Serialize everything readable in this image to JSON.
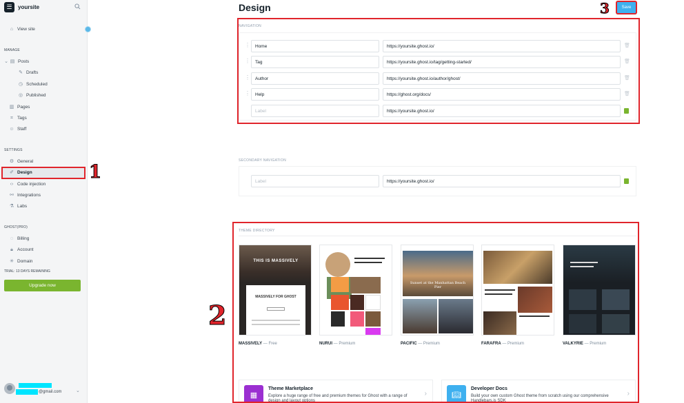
{
  "sidebar": {
    "brand": "yoursite",
    "view_site": "View site",
    "manage_heading": "MANAGE",
    "manage_items": [
      "Posts",
      "Drafts",
      "Scheduled",
      "Published",
      "Pages",
      "Tags",
      "Staff"
    ],
    "settings_heading": "SETTINGS",
    "settings_items": [
      "General",
      "Design",
      "Code injection",
      "Integrations",
      "Labs"
    ],
    "ghost_heading": "GHOST(PRO)",
    "ghost_items": [
      "Billing",
      "Account",
      "Domain"
    ],
    "trial": "TRIAL: 13 DAYS REMAINING",
    "upgrade": "Upgrade now",
    "email_suffix": "@gmail.com"
  },
  "header": {
    "title": "Design",
    "save": "Save"
  },
  "navigation": {
    "label": "NAVIGATION",
    "rows": [
      {
        "label": "Home",
        "url": "https://yoursite.ghost.io/"
      },
      {
        "label": "Tag",
        "url": "https://yoursite.ghost.io/tag/getting-started/"
      },
      {
        "label": "Author",
        "url": "https://yoursite.ghost.io/author/ghost/"
      },
      {
        "label": "Help",
        "url": "https://ghost.org/docs/"
      }
    ],
    "new_placeholder": "Label",
    "new_url": "https://yoursite.ghost.io/"
  },
  "secondary_navigation": {
    "label": "SECONDARY NAVIGATION",
    "new_placeholder": "Label",
    "new_url": "https://yoursite.ghost.io/"
  },
  "theme_directory": {
    "label": "THEME DIRECTORY",
    "themes": [
      {
        "name": "MASSIVELY",
        "tier": "Free",
        "preview_text": "THIS IS MASSIVELY",
        "preview_sub": "MASSIVELY FOR GHOST"
      },
      {
        "name": "NURUI",
        "tier": "Premium"
      },
      {
        "name": "PACIFIC",
        "tier": "Premium",
        "preview_text": "Sunset at the Manhattan Beach Pier"
      },
      {
        "name": "FARAFRA",
        "tier": "Premium"
      },
      {
        "name": "VALKYRIE",
        "tier": "Premium"
      }
    ]
  },
  "cards": [
    {
      "title": "Theme Marketplace",
      "desc": "Explore a huge range of free and premium themes for Ghost with a range of design and layout options",
      "color": "#9b2fd1"
    },
    {
      "title": "Developer Docs",
      "desc": "Build your own custom Ghost theme from scratch using our comprehensive Handlebars.js SDK",
      "color": "#3eb0ef"
    }
  ],
  "annotations": [
    "1",
    "2",
    "3"
  ]
}
